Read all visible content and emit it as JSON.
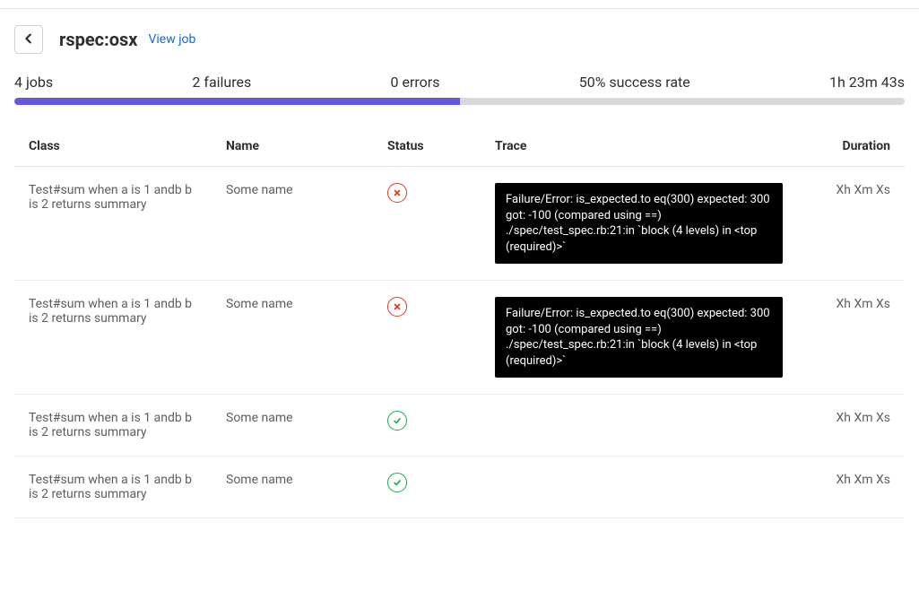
{
  "header": {
    "title": "rspec:osx",
    "view_job": "View job"
  },
  "stats": {
    "jobs": "4 jobs",
    "failures": "2 failures",
    "errors": "0 errors",
    "success_rate": "50% success rate",
    "duration": "1h 23m 43s"
  },
  "progress_percent": 50,
  "columns": {
    "class": "Class",
    "name": "Name",
    "status": "Status",
    "trace": "Trace",
    "duration": "Duration"
  },
  "rows": [
    {
      "class": "Test#sum when a is 1 andb b is 2 returns summary",
      "name": "Some name",
      "status": "fail",
      "trace": "Failure/Error: is_expected.to eq(300) expected: 300 got: -100 (compared using ==) ./spec/test_spec.rb:21:in `block (4 levels) in <top (required)>`",
      "duration": "Xh Xm Xs"
    },
    {
      "class": "Test#sum when a is 1 andb b is 2 returns summary",
      "name": "Some name",
      "status": "fail",
      "trace": "Failure/Error: is_expected.to eq(300) expected: 300 got: -100 (compared using ==) ./spec/test_spec.rb:21:in `block (4 levels) in <top (required)>`",
      "duration": "Xh Xm Xs"
    },
    {
      "class": "Test#sum when a is 1 andb b is 2 returns summary",
      "name": "Some name",
      "status": "pass",
      "trace": "",
      "duration": "Xh Xm Xs"
    },
    {
      "class": "Test#sum when a is 1 andb b is 2 returns summary",
      "name": "Some name",
      "status": "pass",
      "trace": "",
      "duration": "Xh Xm Xs"
    }
  ]
}
